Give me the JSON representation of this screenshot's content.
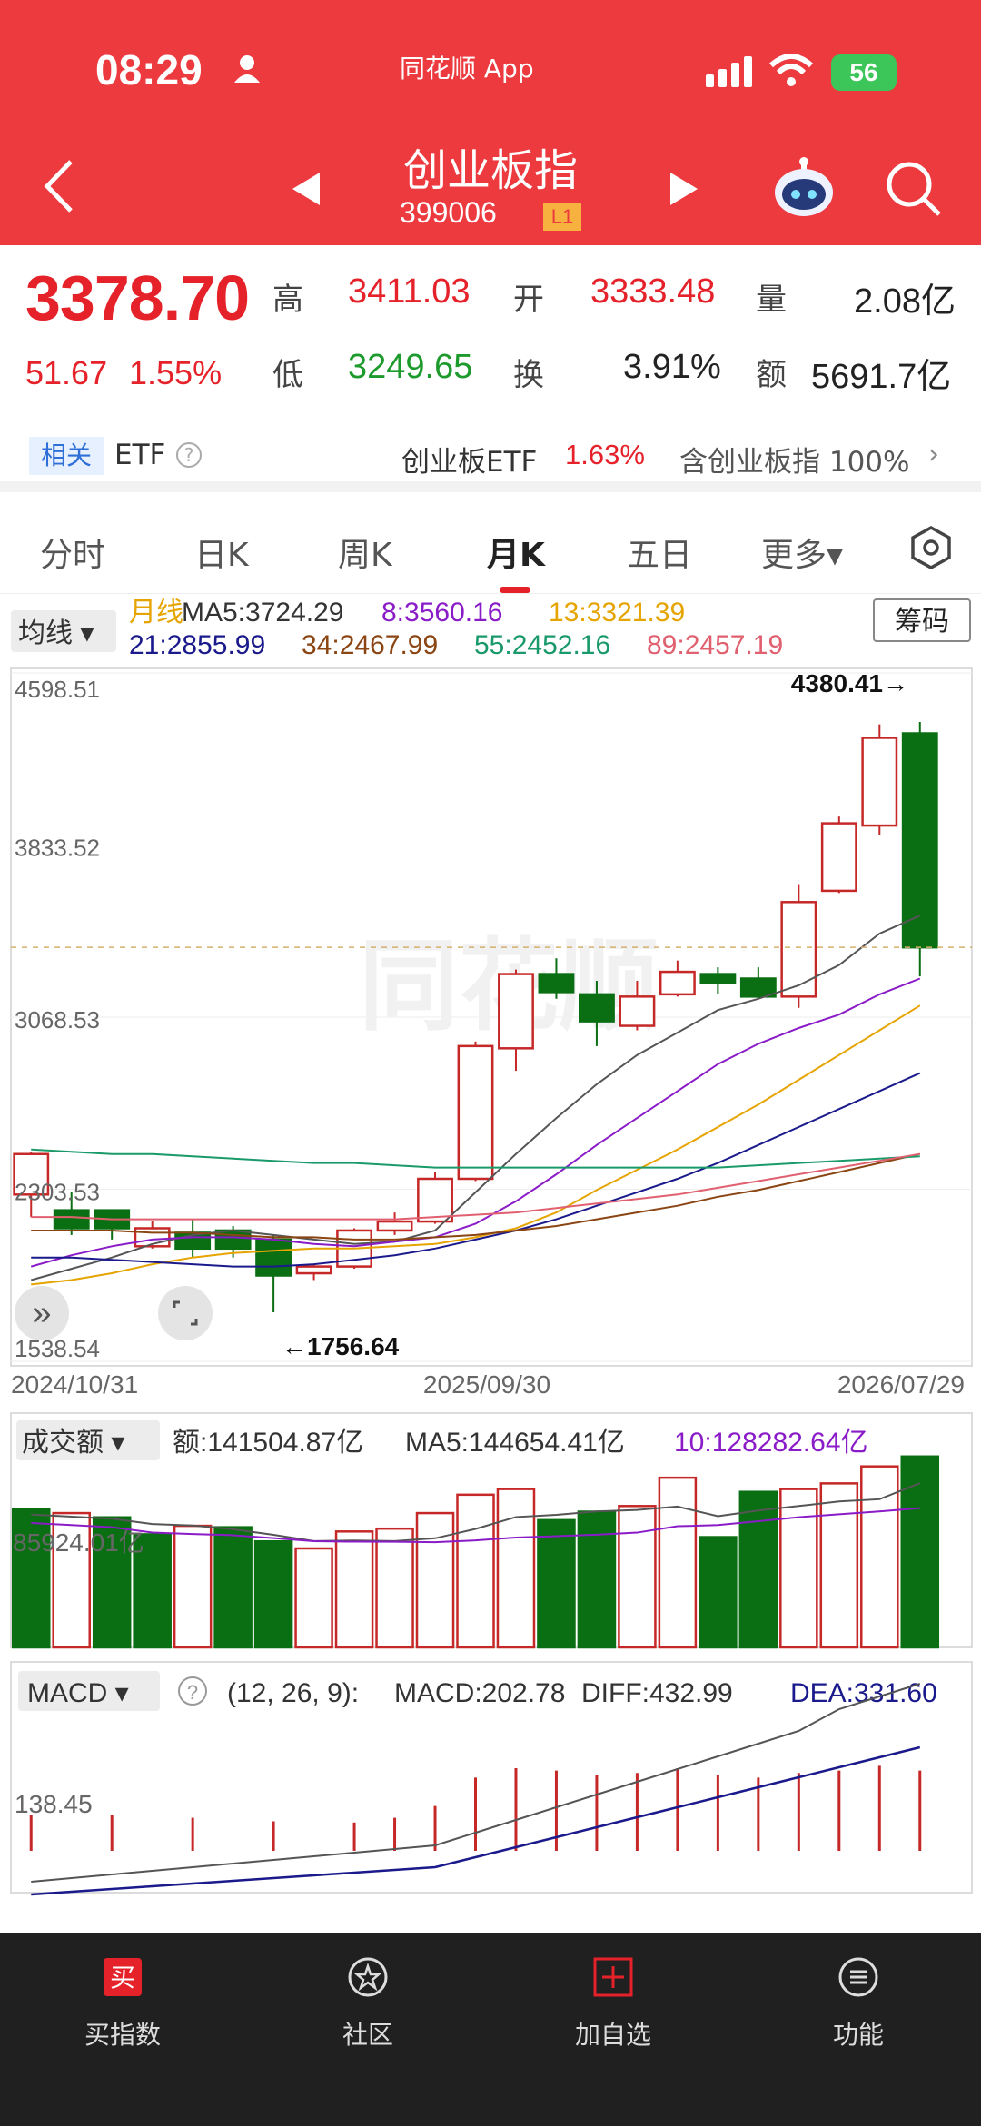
{
  "status": {
    "time": "08:29",
    "app": "同花顺 App",
    "battery": "56"
  },
  "nav": {
    "title": "创业板指",
    "code": "399006",
    "level": "L1"
  },
  "quote": {
    "price": "3378.70",
    "change": "51.67",
    "change_pct": "1.55%",
    "high_label": "高",
    "high": "3411.03",
    "open_label": "开",
    "open": "3333.48",
    "vol_label": "量",
    "vol": "2.08亿",
    "low_label": "低",
    "low": "3249.65",
    "turn_label": "换",
    "turn": "3.91%",
    "amt_label": "额",
    "amt": "5691.7亿"
  },
  "etf": {
    "related": "相关",
    "etf": "ETF",
    "name": "创业板ETF",
    "pct": "1.63%",
    "hold": "含创业板指 100%",
    "arrow": "›"
  },
  "tabs": [
    "分时",
    "日K",
    "周K",
    "月K",
    "五日",
    "更多▾"
  ],
  "ma_panel": {
    "selector": "均线 ▾",
    "chips": "筹码",
    "row1": [
      {
        "t": "月线",
        "c": "#e5a400"
      },
      {
        "t": "MA5:3724.29",
        "c": "#333"
      },
      {
        "t": "8:3560.16",
        "c": "#8a1cc8"
      },
      {
        "t": "13:3321.39",
        "c": "#e5a400"
      }
    ],
    "row2": [
      {
        "t": "21:2855.99",
        "c": "#1a1a8c"
      },
      {
        "t": "34:2467.99",
        "c": "#8b4513"
      },
      {
        "t": "55:2452.16",
        "c": "#1a9a6a"
      },
      {
        "t": "89:2457.19",
        "c": "#e06070"
      }
    ]
  },
  "kchart": {
    "y_labels": [
      "4598.51",
      "3833.52",
      "3068.53",
      "2303.53",
      "1538.54"
    ],
    "x_labels": [
      "2024/10/31",
      "2025/09/30",
      "2026/07/29"
    ],
    "high_mark": "4380.41→",
    "low_mark": "←1756.64",
    "watermark": "同花顺"
  },
  "chart_data": {
    "type": "candlestick",
    "candles": [
      {
        "o": 2280,
        "c": 2460,
        "h": 2470,
        "l": 2180
      },
      {
        "o": 2210,
        "c": 2130,
        "h": 2290,
        "l": 2100
      },
      {
        "o": 2210,
        "c": 2130,
        "h": 2140,
        "l": 2080
      },
      {
        "o": 2050,
        "c": 2130,
        "h": 2160,
        "l": 2040
      },
      {
        "o": 2110,
        "c": 2040,
        "h": 2170,
        "l": 2000
      },
      {
        "o": 2120,
        "c": 2040,
        "h": 2140,
        "l": 2000
      },
      {
        "o": 2080,
        "c": 1920,
        "h": 2100,
        "l": 1756.64
      },
      {
        "o": 1930,
        "c": 1960,
        "h": 1970,
        "l": 1900
      },
      {
        "o": 1960,
        "c": 2120,
        "h": 2130,
        "l": 1950
      },
      {
        "o": 2120,
        "c": 2160,
        "h": 2200,
        "l": 2100
      },
      {
        "o": 2160,
        "c": 2350,
        "h": 2380,
        "l": 2150
      },
      {
        "o": 2350,
        "c": 2940,
        "h": 2960,
        "l": 2340
      },
      {
        "o": 2930,
        "c": 3260,
        "h": 3280,
        "l": 2830
      },
      {
        "o": 3260,
        "c": 3180,
        "h": 3330,
        "l": 3150
      },
      {
        "o": 3170,
        "c": 3050,
        "h": 3230,
        "l": 2940
      },
      {
        "o": 3030,
        "c": 3160,
        "h": 3230,
        "l": 3010
      },
      {
        "o": 3170,
        "c": 3270,
        "h": 3320,
        "l": 3160
      },
      {
        "o": 3260,
        "c": 3220,
        "h": 3290,
        "l": 3170
      },
      {
        "o": 3240,
        "c": 3160,
        "h": 3290,
        "l": 3150
      },
      {
        "o": 3160,
        "c": 3580,
        "h": 3660,
        "l": 3110
      },
      {
        "o": 3630,
        "c": 3930,
        "h": 3960,
        "l": 3620
      },
      {
        "o": 3920,
        "c": 4310,
        "h": 4370,
        "l": 3880
      },
      {
        "o": 4330,
        "c": 3378.7,
        "h": 4380.41,
        "l": 3249.65
      }
    ],
    "ma_lines": [
      {
        "name": "MA5",
        "color": "#555555",
        "values": [
          1900,
          1950,
          2000,
          2060,
          2100,
          2120,
          2100,
          2080,
          2060,
          2070,
          2120,
          2290,
          2460,
          2620,
          2770,
          2900,
          3000,
          3100,
          3150,
          3210,
          3300,
          3440,
          3520
        ]
      },
      {
        "name": "MA8",
        "color": "#8a1cc8",
        "values": [
          1960,
          2010,
          2050,
          2080,
          2090,
          2090,
          2080,
          2060,
          2050,
          2070,
          2090,
          2150,
          2250,
          2370,
          2500,
          2620,
          2740,
          2860,
          2950,
          3020,
          3080,
          3170,
          3240
        ]
      },
      {
        "name": "MA13",
        "color": "#e5a400",
        "values": [
          1880,
          1900,
          1930,
          1970,
          2000,
          2020,
          2030,
          2040,
          2040,
          2050,
          2060,
          2090,
          2130,
          2200,
          2300,
          2390,
          2480,
          2580,
          2680,
          2790,
          2900,
          3010,
          3120
        ]
      },
      {
        "name": "MA21",
        "color": "#1a1a8c",
        "values": [
          2000,
          2000,
          1990,
          1980,
          1970,
          1960,
          1960,
          1970,
          1990,
          2010,
          2040,
          2080,
          2120,
          2170,
          2230,
          2290,
          2350,
          2420,
          2500,
          2580,
          2660,
          2740,
          2820
        ]
      },
      {
        "name": "MA34",
        "color": "#8b4513",
        "values": [
          2120,
          2120,
          2120,
          2110,
          2110,
          2100,
          2090,
          2090,
          2080,
          2080,
          2090,
          2100,
          2120,
          2140,
          2170,
          2200,
          2230,
          2270,
          2300,
          2340,
          2380,
          2420,
          2460
        ]
      },
      {
        "name": "MA55",
        "color": "#1a9a6a",
        "values": [
          2480,
          2470,
          2460,
          2460,
          2450,
          2440,
          2430,
          2420,
          2420,
          2410,
          2400,
          2400,
          2400,
          2400,
          2400,
          2400,
          2400,
          2400,
          2410,
          2420,
          2430,
          2440,
          2450
        ]
      },
      {
        "name": "MA89",
        "color": "#e06070",
        "values": [
          2180,
          2180,
          2170,
          2170,
          2170,
          2170,
          2170,
          2170,
          2170,
          2170,
          2180,
          2190,
          2200,
          2220,
          2240,
          2260,
          2280,
          2310,
          2340,
          2370,
          2400,
          2430,
          2460
        ]
      }
    ],
    "ylim": [
      1538.54,
      4598.51
    ]
  },
  "volume": {
    "selector": "成交额 ▾",
    "label_amt": "额:141504.87亿",
    "label_ma5": "MA5:144654.41亿",
    "label_ma10": "10:128282.64亿",
    "y_label": "85924.01亿",
    "bars": [
      {
        "v": 98,
        "up": false
      },
      {
        "v": 95,
        "up": true
      },
      {
        "v": 92,
        "up": false
      },
      {
        "v": 80,
        "up": false
      },
      {
        "v": 86,
        "up": true
      },
      {
        "v": 85,
        "up": false
      },
      {
        "v": 75,
        "up": false
      },
      {
        "v": 70,
        "up": true
      },
      {
        "v": 82,
        "up": true
      },
      {
        "v": 84,
        "up": true
      },
      {
        "v": 95,
        "up": true
      },
      {
        "v": 108,
        "up": true
      },
      {
        "v": 112,
        "up": true
      },
      {
        "v": 90,
        "up": false
      },
      {
        "v": 96,
        "up": false
      },
      {
        "v": 100,
        "up": true
      },
      {
        "v": 120,
        "up": true
      },
      {
        "v": 78,
        "up": false
      },
      {
        "v": 110,
        "up": false
      },
      {
        "v": 112,
        "up": true
      },
      {
        "v": 116,
        "up": true
      },
      {
        "v": 128,
        "up": true
      },
      {
        "v": 135,
        "up": false
      }
    ]
  },
  "macd": {
    "selector": "MACD ▾",
    "params": "(12, 26, 9):",
    "macd": "MACD:202.78",
    "diff": "DIFF:432.99",
    "dea": "DEA:331.60",
    "y_label": "138.45",
    "bars": [
      30,
      30,
      30,
      30,
      28,
      28,
      25,
      24,
      24,
      28,
      38,
      62,
      70,
      68,
      64,
      66,
      70,
      64,
      62,
      66,
      68,
      72,
      68
    ]
  },
  "tabbar": [
    {
      "label": "买指数",
      "icon": "buy-index-icon"
    },
    {
      "label": "社区",
      "icon": "community-icon"
    },
    {
      "label": "加自选",
      "icon": "add-watchlist-icon"
    },
    {
      "label": "功能",
      "icon": "menu-icon"
    }
  ]
}
